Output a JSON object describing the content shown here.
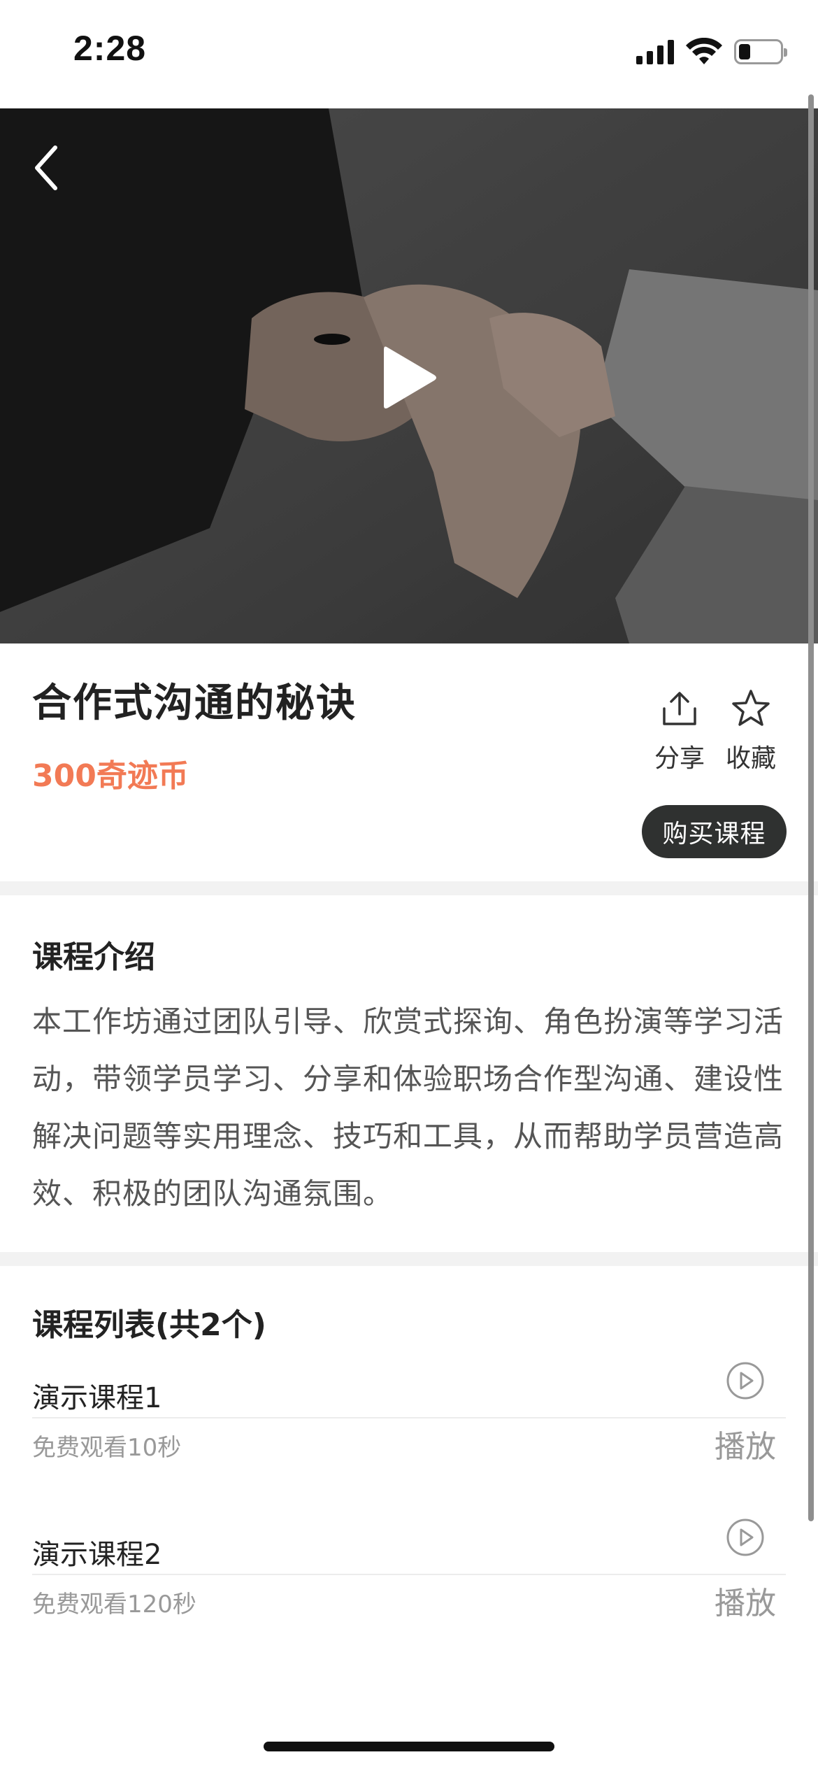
{
  "status_bar": {
    "time": "2:28"
  },
  "course": {
    "title": "合作式沟通的秘诀",
    "price": "300奇迹币",
    "share_label": "分享",
    "favorite_label": "收藏",
    "buy_label": "购买课程"
  },
  "intro": {
    "heading": "课程介绍",
    "text": "本工作坊通过团队引导、欣赏式探询、角色扮演等学习活动，带领学员学习、分享和体验职场合作型沟通、建设性解决问题等实用理念、技巧和工具，从而帮助学员营造高效、积极的团队沟通氛围。"
  },
  "lessons": {
    "heading": "课程列表(共2个)",
    "items": [
      {
        "name": "演示课程1",
        "sub": "免费观看10秒",
        "action": "播放"
      },
      {
        "name": "演示课程2",
        "sub": "免费观看120秒",
        "action": "播放"
      }
    ]
  },
  "colors": {
    "accent_price": "#f27a55",
    "buy_button": "#2f3130"
  },
  "icons": {
    "back": "chevron-left-icon",
    "play_video": "play-triangle-icon",
    "share": "share-icon",
    "favorite": "star-icon",
    "lesson_play": "play-circle-icon"
  }
}
